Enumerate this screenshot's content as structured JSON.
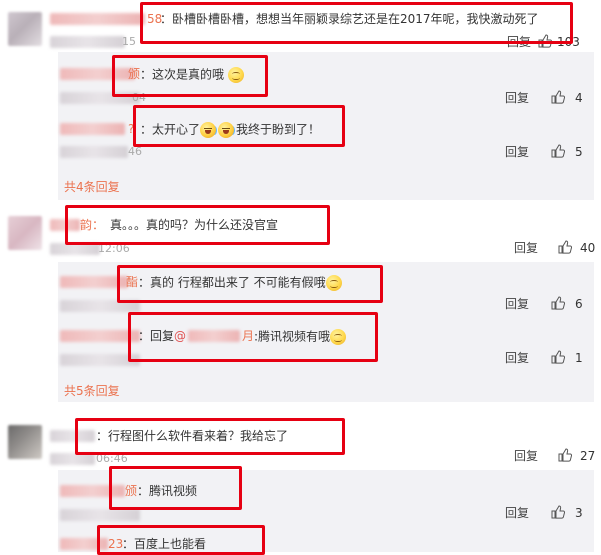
{
  "comments": [
    {
      "nick_suffix": "58",
      "sep": "：",
      "text": "卧槽卧槽卧槽，想想当年丽颖录综艺还是在2017年呢，我快激动死了",
      "time_fragment": "15",
      "reply_label": "回复",
      "likes": "103",
      "replies": [
        {
          "nick_suffix": "颁",
          "text": "：这次是真的哦",
          "time_fragment": "04",
          "reply_label": "回复",
          "likes": "4"
        },
        {
          "nick_suffix": "?",
          "text_a": "：太开心了",
          "text_b": "我终于盼到了！",
          "time_fragment": "46",
          "reply_label": "回复",
          "likes": "5"
        }
      ],
      "more": "共4条回复"
    },
    {
      "nick_suffix": "韵：",
      "text": "真。。。真的吗？为什么还没官宣",
      "time_fragment": "12:06",
      "reply_label": "回复",
      "likes": "40",
      "replies": [
        {
          "nick_suffix": "酯",
          "text": "：真的 行程都出来了 不可能有假哦",
          "reply_label": "回复",
          "likes": "6"
        },
        {
          "text_prefix": "：回复",
          "at": "@",
          "mention_suffix": "月",
          "text": ":腾讯视频有哦",
          "reply_label": "回复",
          "likes": "1"
        }
      ],
      "more": "共5条回复"
    },
    {
      "text": "：行程图什么软件看来着？我给忘了",
      "time_fragment": "06:46",
      "reply_label": "回复",
      "likes": "27",
      "replies": [
        {
          "nick_suffix": "颁",
          "text": "：腾讯视频",
          "reply_label": "回复",
          "likes": "3"
        },
        {
          "nick_suffix": "23",
          "text": "：百度上也能看"
        }
      ]
    }
  ],
  "icons": {
    "like": "thumbs-up-icon",
    "smile": "smile-emoji",
    "cry": "tears-of-joy-emoji"
  },
  "colors": {
    "highlight_box": "#e60012",
    "nick": "#eb7350",
    "reply_bg": "#f2f2f5"
  }
}
